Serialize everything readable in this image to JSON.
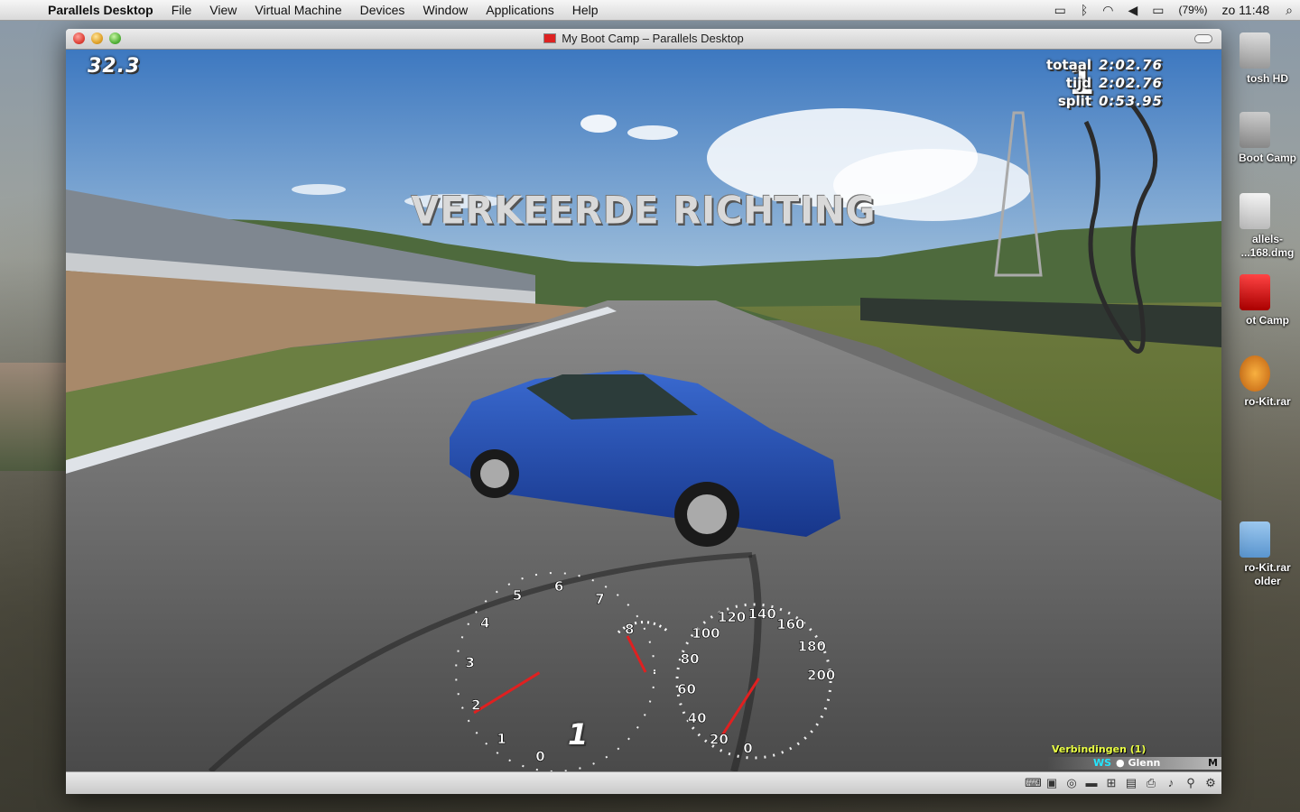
{
  "menubar": {
    "apple": "",
    "app": "Parallels Desktop",
    "items": [
      "File",
      "View",
      "Virtual Machine",
      "Devices",
      "Window",
      "Applications",
      "Help"
    ],
    "battery": "(79%)",
    "clock": "zo 11:48"
  },
  "desktop_icons": [
    {
      "label1": "tosh HD",
      "label2": ""
    },
    {
      "label1": "Boot Camp",
      "label2": ""
    },
    {
      "label1": "allels-",
      "label2": "...168.dmg"
    },
    {
      "label1": "ot Camp",
      "label2": ""
    },
    {
      "label1": "ro-Kit.rar",
      "label2": ""
    },
    {
      "label1": "ro-Kit.rar",
      "label2": "older"
    }
  ],
  "window": {
    "title": "My Boot Camp – Parallels Desktop"
  },
  "hud": {
    "speed_top": "32.3",
    "position": "1",
    "laps": [
      {
        "key": "totaal",
        "value": "2:02.76"
      },
      {
        "key": "tijd",
        "value": "2:02.76"
      },
      {
        "key": "split",
        "value": "0:53.95"
      }
    ],
    "wrong_way": "VERKEERDE RICHTING",
    "gear": "1",
    "rpm_ticks": [
      "0",
      "1",
      "2",
      "3",
      "4",
      "5",
      "6",
      "7",
      "8"
    ],
    "speed_ticks": [
      "0",
      "20",
      "40",
      "60",
      "80",
      "100",
      "120",
      "140",
      "160",
      "180",
      "200"
    ],
    "rpm_value": 2.2,
    "speed_value": 32.3,
    "fuel_level": 0.35
  },
  "connections": {
    "heading": "Verbindingen (1)",
    "tag": "WS",
    "bullet": "●",
    "player": "Glenn",
    "mode": "M"
  },
  "colors": {
    "car": "#1f4ba0",
    "needle": "#e02020",
    "conn_heading": "#eaff44",
    "conn_tag": "#23e6ff"
  }
}
